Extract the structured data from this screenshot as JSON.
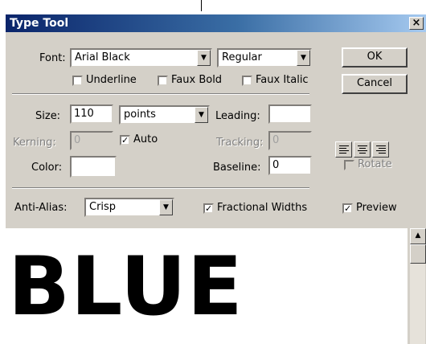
{
  "window": {
    "title": "Type Tool",
    "close_glyph": "×"
  },
  "font": {
    "label": "Font:",
    "family": "Arial Black",
    "style": "Regular"
  },
  "buttons": {
    "ok": "OK",
    "cancel": "Cancel"
  },
  "options": {
    "underline": "Underline",
    "faux_bold": "Faux Bold",
    "faux_italic": "Faux Italic",
    "underline_checked": false,
    "faux_bold_checked": false,
    "faux_italic_checked": false
  },
  "size": {
    "label": "Size:",
    "value": "110",
    "unit": "points"
  },
  "leading": {
    "label": "Leading:",
    "value": ""
  },
  "kerning": {
    "label": "Kerning:",
    "value": "0",
    "auto_label": "Auto",
    "auto_checked": true
  },
  "tracking": {
    "label": "Tracking:",
    "value": "0"
  },
  "color": {
    "label": "Color:",
    "swatch": "#ffffff"
  },
  "baseline": {
    "label": "Baseline:",
    "value": "0"
  },
  "rotate": {
    "label": "Rotate",
    "checked": false
  },
  "antialias": {
    "label": "Anti-Alias:",
    "value": "Crisp"
  },
  "fractional_widths": {
    "label": "Fractional Widths",
    "checked": true
  },
  "preview": {
    "label": "Preview",
    "checked": true,
    "text": "BLUE"
  },
  "glyphs": {
    "check": "✓",
    "down_arrow": "▼",
    "up_arrow": "▲"
  }
}
